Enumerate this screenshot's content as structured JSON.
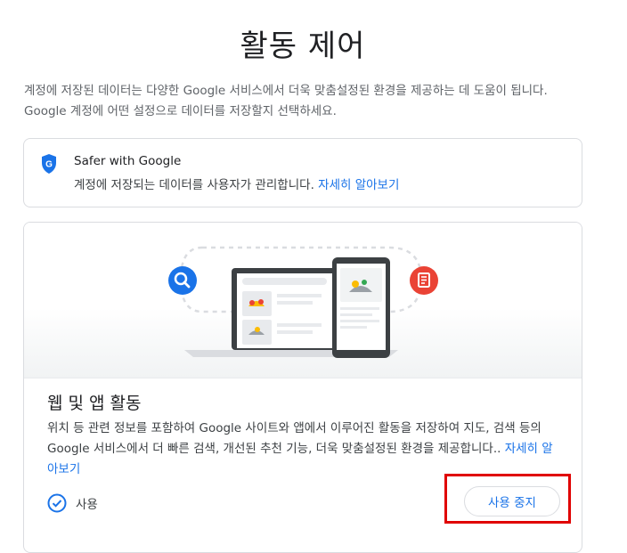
{
  "page": {
    "title": "활동 제어",
    "intro": "계정에 저장된 데이터는 다양한 Google 서비스에서 더욱 맞춤설정된 환경을 제공하는 데 도움이 됩니다. Google 계정에 어떤 설정으로 데이터를 저장할지 선택하세요."
  },
  "safer": {
    "icon": "google-shield-icon",
    "shield_letter": "G",
    "title": "Safer with Google",
    "description": "계정에 저장되는 데이터를 사용자가 관리합니다. ",
    "link": "자세히 알아보기"
  },
  "activity": {
    "title": "웹 및 앱 활동",
    "description": "위치 등 관련 정보를 포함하여 Google 사이트와 앱에서 이루어진 활동을 저장하여 지도, 검색 등의 Google 서비스에서 더 빠른 검색, 개선된 추천 기능, 더욱 맞춤설정된 환경을 제공합니다.. ",
    "link": "자세히 알아보기",
    "status_label": "사용",
    "status_icon": "check-circle-icon",
    "stop_button": "사용 중지"
  },
  "illustration": {
    "icons": [
      "search-icon",
      "laptop-icon",
      "phone-icon",
      "document-icon"
    ]
  },
  "colors": {
    "accent": "#1a73e8",
    "search_circle": "#1a73e8",
    "document_circle": "#ea4335",
    "highlight": "#e00000"
  }
}
